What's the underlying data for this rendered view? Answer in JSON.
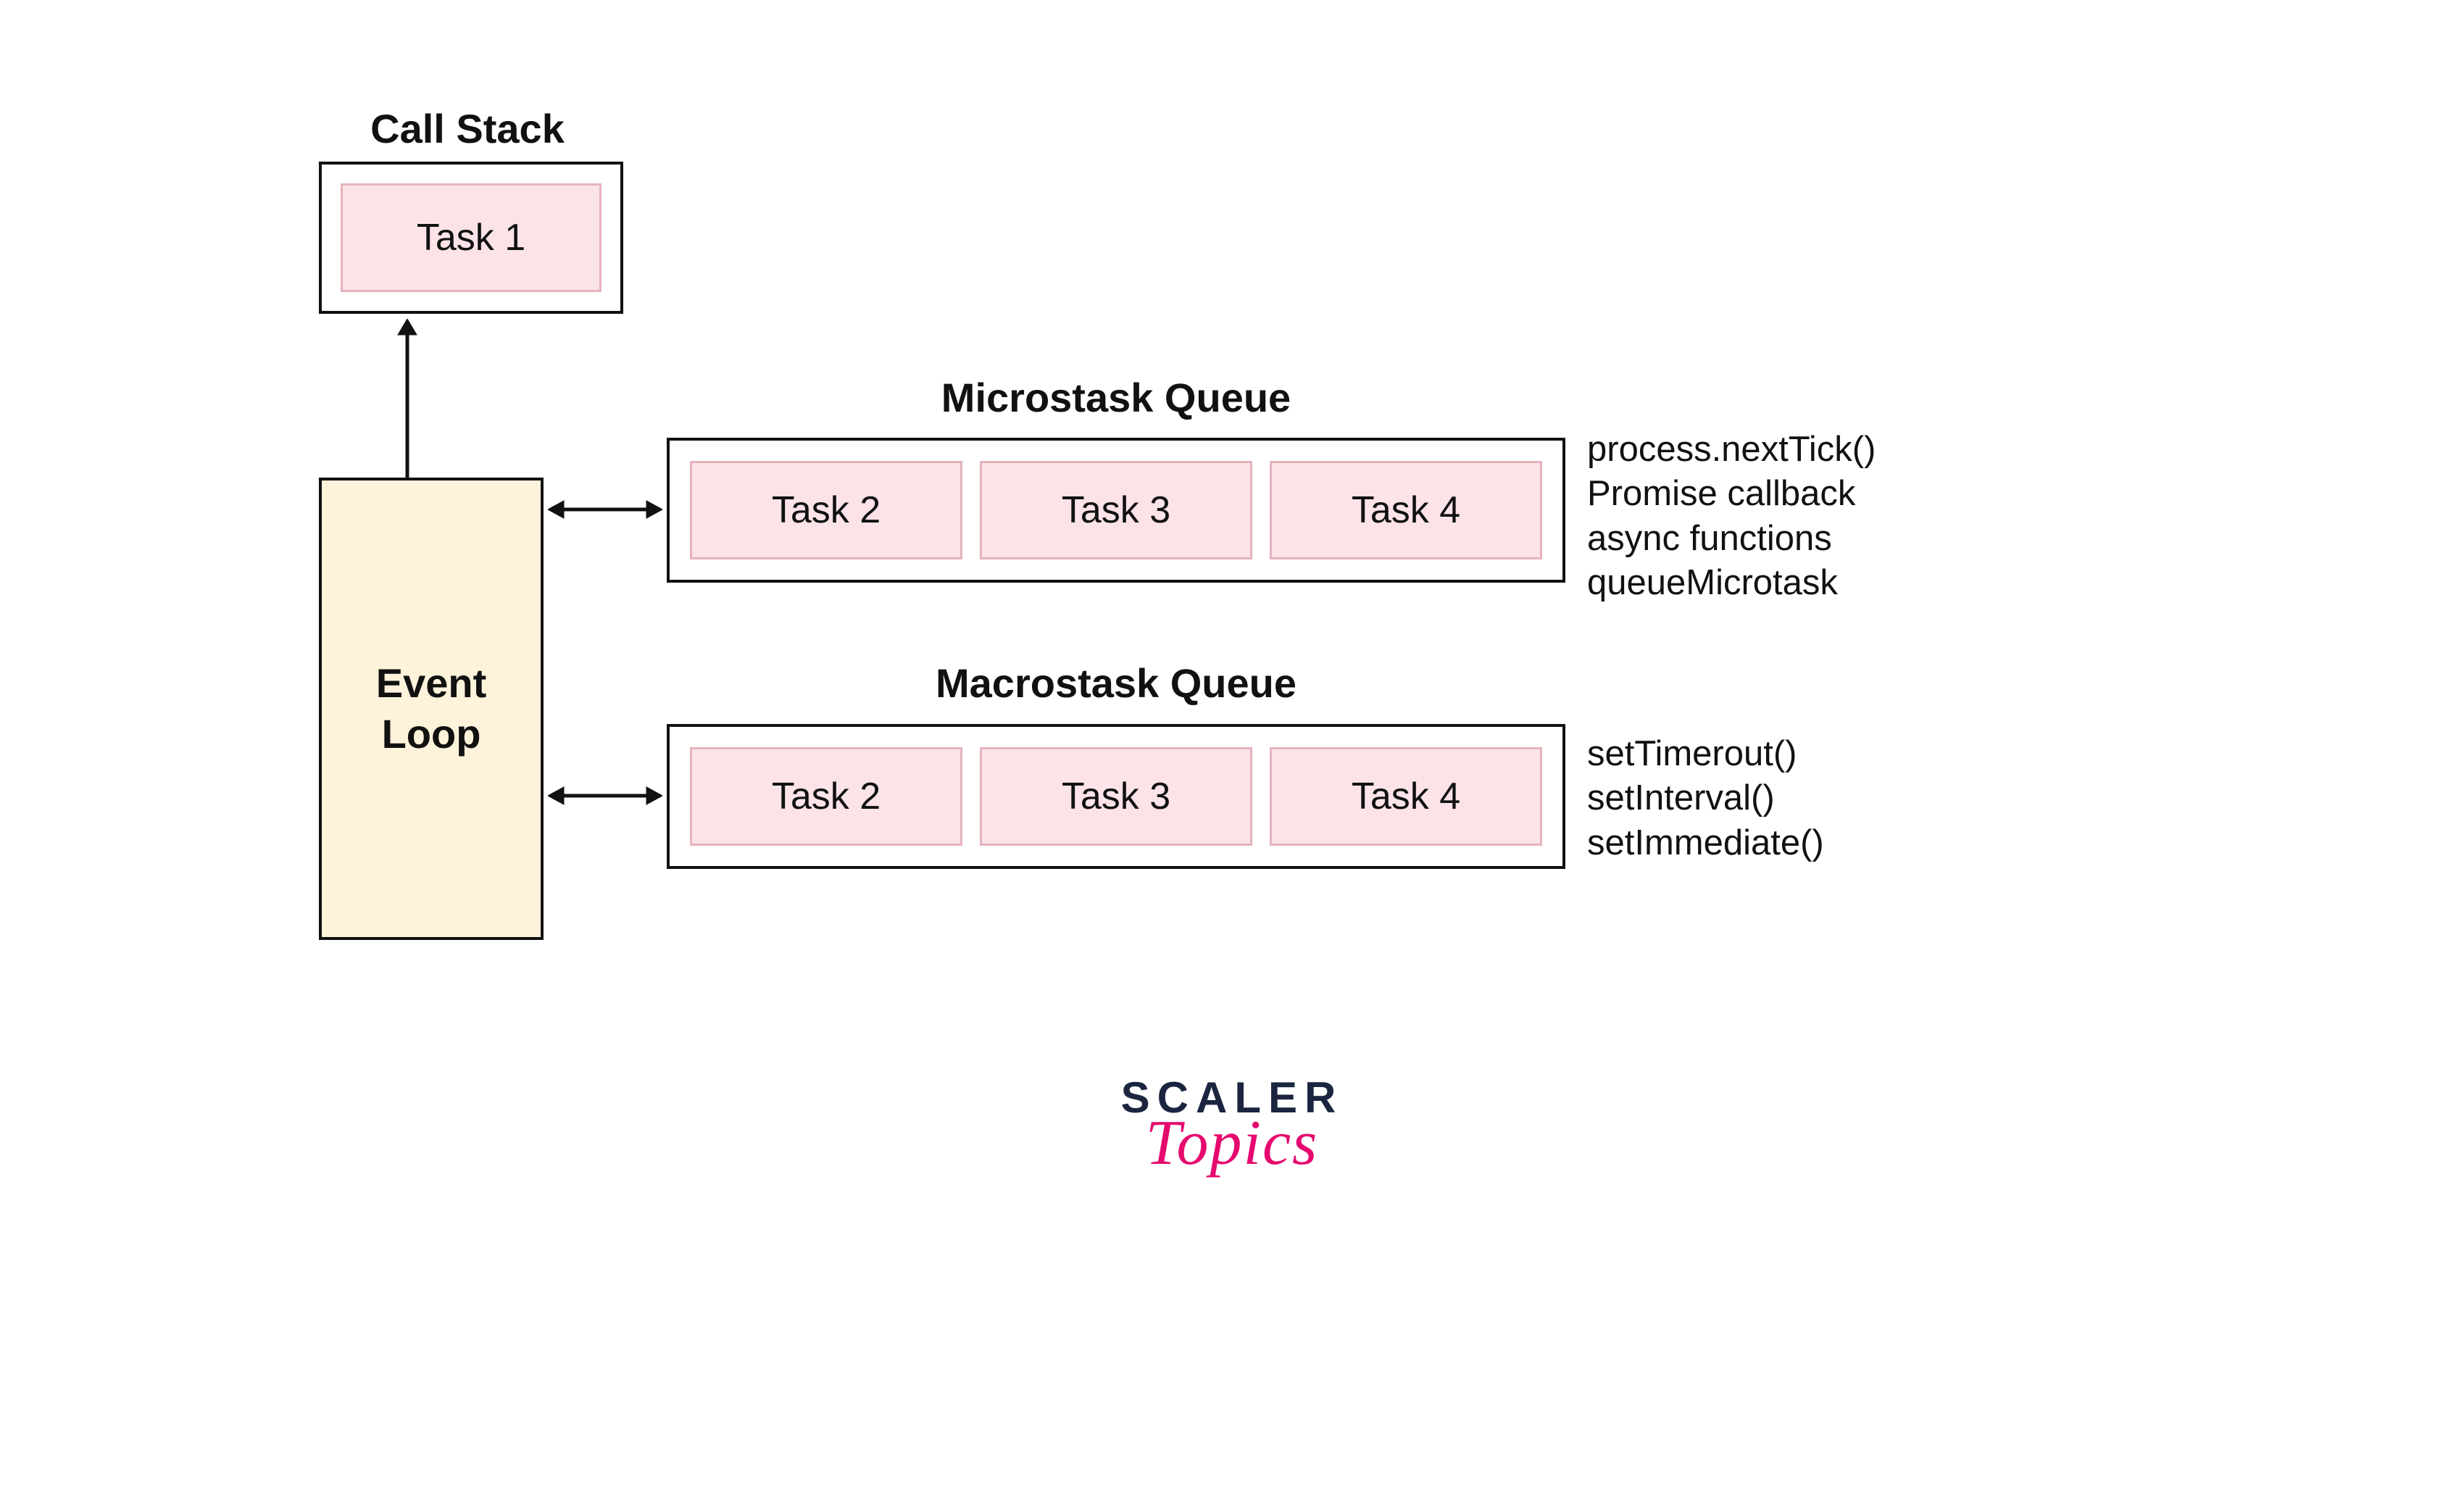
{
  "callstack": {
    "title": "Call Stack",
    "tasks": [
      "Task 1"
    ]
  },
  "eventloop": {
    "label": "Event\nLoop"
  },
  "queues": [
    {
      "id": "microtask",
      "title": "Microstask Queue",
      "tasks": [
        "Task 2",
        "Task 3",
        "Task 4"
      ],
      "desc": [
        "process.nextTick()",
        "Promise callback",
        "async functions",
        "queueMicrotask"
      ]
    },
    {
      "id": "macrotask",
      "title": "Macrostask Queue",
      "tasks": [
        "Task 2",
        "Task 3",
        "Task 4"
      ],
      "desc": [
        "setTimerout()",
        "setInterval()",
        "setImmediate()"
      ]
    }
  ],
  "logo": {
    "line1": "SCALER",
    "line2": "Topics"
  },
  "colors": {
    "task_fill": "#fbe3e8",
    "task_border": "#e6b3bd",
    "eventloop_fill": "#fdf2da",
    "border": "#111111"
  }
}
